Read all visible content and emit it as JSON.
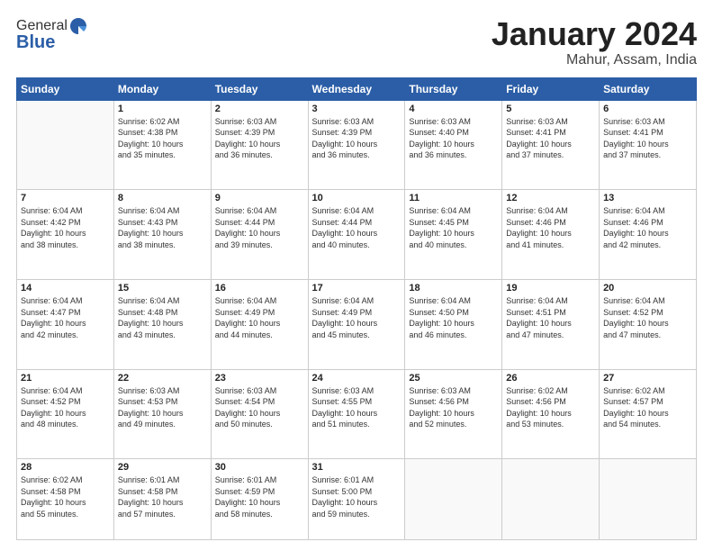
{
  "header": {
    "logo_general": "General",
    "logo_blue": "Blue",
    "main_title": "January 2024",
    "sub_title": "Mahur, Assam, India"
  },
  "days_of_week": [
    "Sunday",
    "Monday",
    "Tuesday",
    "Wednesday",
    "Thursday",
    "Friday",
    "Saturday"
  ],
  "weeks": [
    [
      {
        "day": "",
        "content": ""
      },
      {
        "day": "1",
        "content": "Sunrise: 6:02 AM\nSunset: 4:38 PM\nDaylight: 10 hours\nand 35 minutes."
      },
      {
        "day": "2",
        "content": "Sunrise: 6:03 AM\nSunset: 4:39 PM\nDaylight: 10 hours\nand 36 minutes."
      },
      {
        "day": "3",
        "content": "Sunrise: 6:03 AM\nSunset: 4:39 PM\nDaylight: 10 hours\nand 36 minutes."
      },
      {
        "day": "4",
        "content": "Sunrise: 6:03 AM\nSunset: 4:40 PM\nDaylight: 10 hours\nand 36 minutes."
      },
      {
        "day": "5",
        "content": "Sunrise: 6:03 AM\nSunset: 4:41 PM\nDaylight: 10 hours\nand 37 minutes."
      },
      {
        "day": "6",
        "content": "Sunrise: 6:03 AM\nSunset: 4:41 PM\nDaylight: 10 hours\nand 37 minutes."
      }
    ],
    [
      {
        "day": "7",
        "content": "Sunrise: 6:04 AM\nSunset: 4:42 PM\nDaylight: 10 hours\nand 38 minutes."
      },
      {
        "day": "8",
        "content": "Sunrise: 6:04 AM\nSunset: 4:43 PM\nDaylight: 10 hours\nand 38 minutes."
      },
      {
        "day": "9",
        "content": "Sunrise: 6:04 AM\nSunset: 4:44 PM\nDaylight: 10 hours\nand 39 minutes."
      },
      {
        "day": "10",
        "content": "Sunrise: 6:04 AM\nSunset: 4:44 PM\nDaylight: 10 hours\nand 40 minutes."
      },
      {
        "day": "11",
        "content": "Sunrise: 6:04 AM\nSunset: 4:45 PM\nDaylight: 10 hours\nand 40 minutes."
      },
      {
        "day": "12",
        "content": "Sunrise: 6:04 AM\nSunset: 4:46 PM\nDaylight: 10 hours\nand 41 minutes."
      },
      {
        "day": "13",
        "content": "Sunrise: 6:04 AM\nSunset: 4:46 PM\nDaylight: 10 hours\nand 42 minutes."
      }
    ],
    [
      {
        "day": "14",
        "content": "Sunrise: 6:04 AM\nSunset: 4:47 PM\nDaylight: 10 hours\nand 42 minutes."
      },
      {
        "day": "15",
        "content": "Sunrise: 6:04 AM\nSunset: 4:48 PM\nDaylight: 10 hours\nand 43 minutes."
      },
      {
        "day": "16",
        "content": "Sunrise: 6:04 AM\nSunset: 4:49 PM\nDaylight: 10 hours\nand 44 minutes."
      },
      {
        "day": "17",
        "content": "Sunrise: 6:04 AM\nSunset: 4:49 PM\nDaylight: 10 hours\nand 45 minutes."
      },
      {
        "day": "18",
        "content": "Sunrise: 6:04 AM\nSunset: 4:50 PM\nDaylight: 10 hours\nand 46 minutes."
      },
      {
        "day": "19",
        "content": "Sunrise: 6:04 AM\nSunset: 4:51 PM\nDaylight: 10 hours\nand 47 minutes."
      },
      {
        "day": "20",
        "content": "Sunrise: 6:04 AM\nSunset: 4:52 PM\nDaylight: 10 hours\nand 47 minutes."
      }
    ],
    [
      {
        "day": "21",
        "content": "Sunrise: 6:04 AM\nSunset: 4:52 PM\nDaylight: 10 hours\nand 48 minutes."
      },
      {
        "day": "22",
        "content": "Sunrise: 6:03 AM\nSunset: 4:53 PM\nDaylight: 10 hours\nand 49 minutes."
      },
      {
        "day": "23",
        "content": "Sunrise: 6:03 AM\nSunset: 4:54 PM\nDaylight: 10 hours\nand 50 minutes."
      },
      {
        "day": "24",
        "content": "Sunrise: 6:03 AM\nSunset: 4:55 PM\nDaylight: 10 hours\nand 51 minutes."
      },
      {
        "day": "25",
        "content": "Sunrise: 6:03 AM\nSunset: 4:56 PM\nDaylight: 10 hours\nand 52 minutes."
      },
      {
        "day": "26",
        "content": "Sunrise: 6:02 AM\nSunset: 4:56 PM\nDaylight: 10 hours\nand 53 minutes."
      },
      {
        "day": "27",
        "content": "Sunrise: 6:02 AM\nSunset: 4:57 PM\nDaylight: 10 hours\nand 54 minutes."
      }
    ],
    [
      {
        "day": "28",
        "content": "Sunrise: 6:02 AM\nSunset: 4:58 PM\nDaylight: 10 hours\nand 55 minutes."
      },
      {
        "day": "29",
        "content": "Sunrise: 6:01 AM\nSunset: 4:58 PM\nDaylight: 10 hours\nand 57 minutes."
      },
      {
        "day": "30",
        "content": "Sunrise: 6:01 AM\nSunset: 4:59 PM\nDaylight: 10 hours\nand 58 minutes."
      },
      {
        "day": "31",
        "content": "Sunrise: 6:01 AM\nSunset: 5:00 PM\nDaylight: 10 hours\nand 59 minutes."
      },
      {
        "day": "",
        "content": ""
      },
      {
        "day": "",
        "content": ""
      },
      {
        "day": "",
        "content": ""
      }
    ]
  ]
}
